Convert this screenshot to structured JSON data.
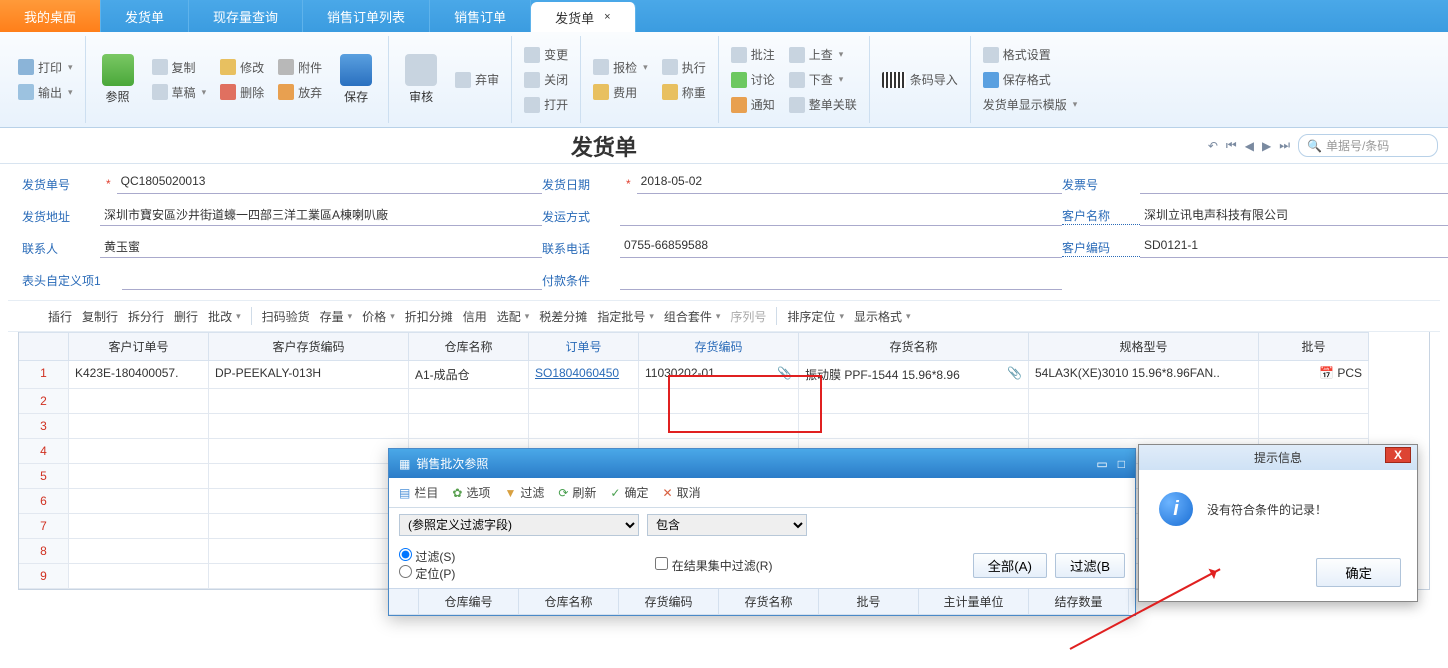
{
  "tabs": [
    "我的桌面",
    "发货单",
    "现存量查询",
    "销售订单列表",
    "销售订单",
    "发货单"
  ],
  "ribbon": {
    "print": "打印",
    "export": "输出",
    "ref": "参照",
    "copy": "复制",
    "modify": "修改",
    "attach": "附件",
    "draft": "草稿",
    "del": "删除",
    "discard": "放弃",
    "save": "保存",
    "audit": "审核",
    "abandon": "弃审",
    "change": "变更",
    "close": "关闭",
    "open": "打开",
    "inspect": "报检",
    "exec": "执行",
    "fee": "费用",
    "weigh": "称重",
    "note": "批注",
    "discuss": "讨论",
    "notify": "通知",
    "up": "上查",
    "down": "下查",
    "adj": "整单关联",
    "barcode": "条码导入",
    "fmt": "格式设置",
    "savefmt": "保存格式",
    "template": "发货单显示模版"
  },
  "page_title": "发货单",
  "search_placeholder": "单据号/条码",
  "form": {
    "no_label": "发货单号",
    "no": "QC1805020013",
    "date_label": "发货日期",
    "date": "2018-05-02",
    "inv_label": "发票号",
    "addr_label": "发货地址",
    "addr": "深圳市寶安區沙井街道蠔一四部三洋工業區A棟喇叭廠",
    "ship_label": "发运方式",
    "cust_label": "客户名称",
    "cust": "深圳立讯电声科技有限公司",
    "contact_label": "联系人",
    "contact": "黄玉蜜",
    "tel_label": "联系电话",
    "tel": "0755-66859588",
    "code_label": "客户编码",
    "code": "SD0121-1",
    "custom_label": "表头自定义项1",
    "pay_label": "付款条件"
  },
  "actions": [
    "插行",
    "复制行",
    "拆分行",
    "删行",
    "批改",
    "扫码验货",
    "存量",
    "价格",
    "折扣分摊",
    "信用",
    "选配",
    "税差分摊",
    "指定批号",
    "组合套件",
    "序列号",
    "排序定位",
    "显示格式"
  ],
  "cols": [
    "",
    "客户订单号",
    "客户存货编码",
    "仓库名称",
    "订单号",
    "存货编码",
    "存货名称",
    "规格型号",
    "批号"
  ],
  "row": {
    "n": "1",
    "ord": "K423E-180400057.",
    "inv": "DP-PEEKALY-013H",
    "wh": "A1-成品仓",
    "so": "SO1804060450",
    "code": "11030202-01",
    "name": "振动膜 PPF-1544 15.96*8.96",
    "spec": "54LA3K(XE)3010 15.96*8.96FAN..",
    "unit": "PCS"
  },
  "dialog": {
    "title": "销售批次参照",
    "tb": {
      "cols": "栏目",
      "opts": "选项",
      "filter": "过滤",
      "refresh": "刷新",
      "ok": "确定",
      "cancel": "取消"
    },
    "field_ph": "(参照定义过滤字段)",
    "op": "包含",
    "r_filter": "过滤(S)",
    "r_locate": "定位(P)",
    "chk": "在结果集中过滤(R)",
    "btn_all": "全部(A)",
    "btn_filter": "过滤(B",
    "gcols": [
      "",
      "仓库编号",
      "仓库名称",
      "存货编码",
      "存货名称",
      "批号",
      "主计量单位",
      "结存数量"
    ]
  },
  "alert": {
    "title": "提示信息",
    "msg": "没有符合条件的记录！",
    "ok": "确定"
  }
}
